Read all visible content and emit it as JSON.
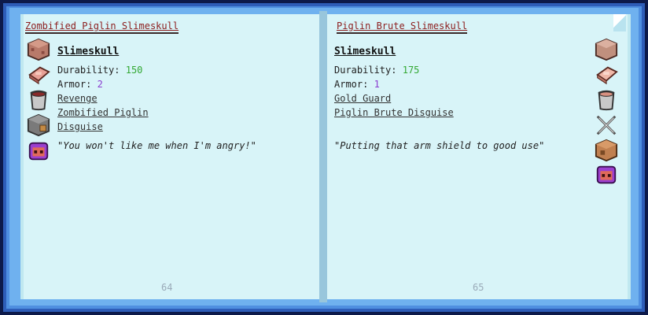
{
  "left": {
    "title": "Zombified Piglin Slimeskull",
    "heading": "Slimeskull",
    "durability_label": "Durability:",
    "durability_value": "150",
    "armor_label": "Armor:",
    "armor_value": "2",
    "links": [
      "Revenge",
      "Zombified Piglin",
      "Disguise"
    ],
    "quote": "\"You won't like me when I'm angry!\"",
    "page_number": "64",
    "icons": [
      "block-icon",
      "ingot-icon",
      "bucket-icon",
      "dispenser-icon",
      "slime-head-icon"
    ]
  },
  "right": {
    "title": "Piglin Brute Slimeskull",
    "heading": "Slimeskull",
    "durability_label": "Durability:",
    "durability_value": "175",
    "armor_label": "Armor:",
    "armor_value": "1",
    "links": [
      "Gold Guard",
      "Piglin Brute Disguise"
    ],
    "quote": "\"Putting that arm shield to good use\"",
    "page_number": "65",
    "icons": [
      "block-icon",
      "ingot-icon",
      "bucket-icon",
      "crossed-swords-icon",
      "dispenser-icon",
      "slime-head-icon"
    ]
  },
  "colors": {
    "page_bg": "#d8f4f8",
    "title_red": "#8c1d1d",
    "durability_green": "#33a833",
    "armor_purple": "#8a3dd0"
  }
}
